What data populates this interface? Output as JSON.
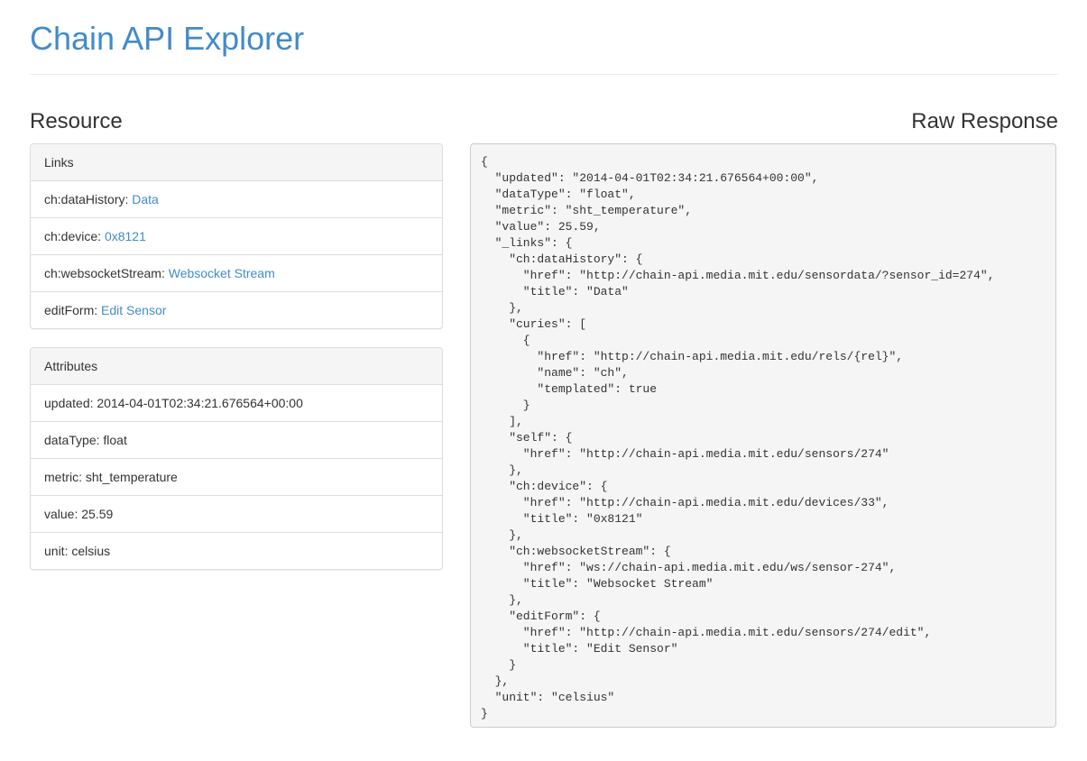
{
  "header": {
    "title": "Chain API Explorer"
  },
  "resource": {
    "heading": "Resource",
    "links_panel": {
      "heading": "Links",
      "items": [
        {
          "key": "ch:dataHistory: ",
          "link": "Data"
        },
        {
          "key": "ch:device: ",
          "link": "0x8121"
        },
        {
          "key": "ch:websocketStream: ",
          "link": "Websocket Stream"
        },
        {
          "key": "editForm: ",
          "link": "Edit Sensor"
        }
      ]
    },
    "attributes_panel": {
      "heading": "Attributes",
      "items": [
        "updated: 2014-04-01T02:34:21.676564+00:00",
        "dataType: float",
        "metric: sht_temperature",
        "value: 25.59",
        "unit: celsius"
      ]
    }
  },
  "raw_response": {
    "heading": "Raw Response",
    "body": "{\n  \"updated\": \"2014-04-01T02:34:21.676564+00:00\",\n  \"dataType\": \"float\",\n  \"metric\": \"sht_temperature\",\n  \"value\": 25.59,\n  \"_links\": {\n    \"ch:dataHistory\": {\n      \"href\": \"http://chain-api.media.mit.edu/sensordata/?sensor_id=274\",\n      \"title\": \"Data\"\n    },\n    \"curies\": [\n      {\n        \"href\": \"http://chain-api.media.mit.edu/rels/{rel}\",\n        \"name\": \"ch\",\n        \"templated\": true\n      }\n    ],\n    \"self\": {\n      \"href\": \"http://chain-api.media.mit.edu/sensors/274\"\n    },\n    \"ch:device\": {\n      \"href\": \"http://chain-api.media.mit.edu/devices/33\",\n      \"title\": \"0x8121\"\n    },\n    \"ch:websocketStream\": {\n      \"href\": \"ws://chain-api.media.mit.edu/ws/sensor-274\",\n      \"title\": \"Websocket Stream\"\n    },\n    \"editForm\": {\n      \"href\": \"http://chain-api.media.mit.edu/sensors/274/edit\",\n      \"title\": \"Edit Sensor\"\n    }\n  },\n  \"unit\": \"celsius\"\n}"
  }
}
